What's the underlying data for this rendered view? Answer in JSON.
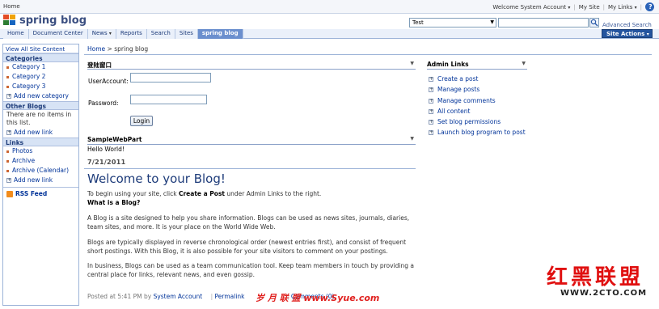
{
  "topbar": {
    "home": "Home",
    "welcome": "Welcome System Account",
    "my_site": "My Site",
    "my_links": "My Links",
    "help": "?"
  },
  "header": {
    "site_title": "spring blog",
    "scope_value": "Test",
    "advanced_search": "Advanced Search",
    "site_actions": "Site Actions"
  },
  "tabs": [
    "Home",
    "Document Center",
    "News",
    "Reports",
    "Search",
    "Sites",
    "spring blog"
  ],
  "leftnav": {
    "view_all": "View All Site Content",
    "categories_title": "Categories",
    "categories": [
      "Category 1",
      "Category 2",
      "Category 3"
    ],
    "add_category": "Add new category",
    "other_blogs_title": "Other Blogs",
    "other_blogs_note": "There are no items in this list.",
    "add_link": "Add new link",
    "links_title": "Links",
    "links": [
      "Photos",
      "Archive",
      "Archive (Calendar)"
    ],
    "add_link2": "Add new link",
    "rss": "RSS Feed"
  },
  "breadcrumb": {
    "home": "Home",
    "sep": ">",
    "current": "spring blog"
  },
  "login_part": {
    "title": "登陆窗口",
    "user_label": "UserAccount:",
    "password_label": "Password:",
    "button": "Login"
  },
  "sample_part": {
    "title": "SampleWebPart",
    "content": "Hello World!"
  },
  "post": {
    "date": "7/21/2011",
    "title": "Welcome to your Blog!",
    "intro_pre": "To begin using your site, click ",
    "intro_bold": "Create a Post",
    "intro_post": " under Admin Links to the right.",
    "what_heading": "What is a Blog?",
    "para1": "A Blog is a site designed to help you share information. Blogs can be used as news sites, journals, diaries, team sites, and more. It is your place on the World Wide Web.",
    "para2": "Blogs are typically displayed in reverse chronological order (newest entries first), and consist of frequent short postings. With this Blog, it is also possible for your site visitors to comment on your postings.",
    "para3": "In business, Blogs can be used as a team communication tool. Keep team members in touch by providing a central place for links, relevant news, and even gossip.",
    "posted_at": "Posted at 5:41 PM by",
    "author": "System Account",
    "permalink": "Permalink",
    "comments": "Comments (0)"
  },
  "admin": {
    "title": "Admin Links",
    "items": [
      "Create a post",
      "Manage posts",
      "Manage comments",
      "All content",
      "Set blog permissions",
      "Launch blog program to post"
    ]
  },
  "watermarks": {
    "brand_cn": "红黑联盟",
    "brand_url": "WWW.2CTO.COM",
    "syue": "岁 月 联 盟  www.Syue.com"
  },
  "colors": {
    "brand_blue": "#3b4f81",
    "active_tab": "#6b8fce",
    "site_actions": "#24549e",
    "link": "#003399"
  }
}
